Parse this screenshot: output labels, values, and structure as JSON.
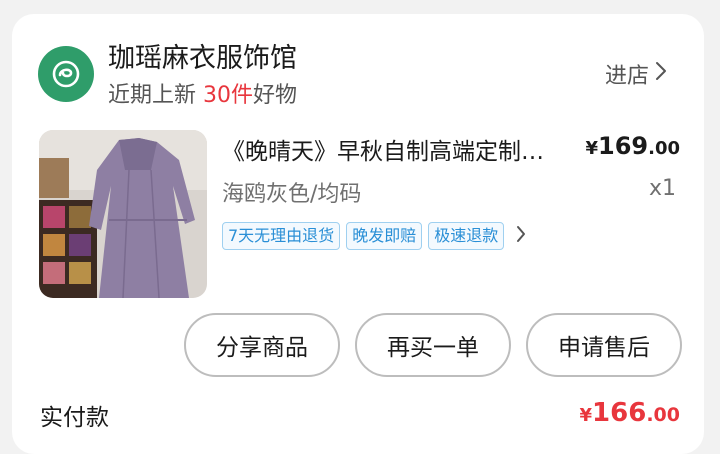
{
  "shop": {
    "name": "珈瑶麻衣服饰馆",
    "subtitle_prefix": "近期上新",
    "new_count": "30件",
    "subtitle_suffix": "好物",
    "enter_label": "进店",
    "logo_icon": "shop-logo-icon",
    "logo_color": "#2f9d6a"
  },
  "product": {
    "title": "《晚晴天》早秋自制高端定制系列",
    "price_currency": "¥",
    "price_integer": "169",
    "price_decimal": ".00",
    "variant": "海鸥灰色/均码",
    "quantity": "x1",
    "tags": [
      "7天无理由退货",
      "晚发即赔",
      "极速退款"
    ],
    "image_icon": "dress-photo"
  },
  "actions": {
    "share": "分享商品",
    "rebuy": "再买一单",
    "after_sale": "申请售后"
  },
  "payment": {
    "label": "实付款",
    "currency": "¥",
    "integer": "166",
    "decimal": ".00"
  },
  "colors": {
    "accent_red": "#e8363d",
    "tag_blue": "#2a8fd6"
  }
}
